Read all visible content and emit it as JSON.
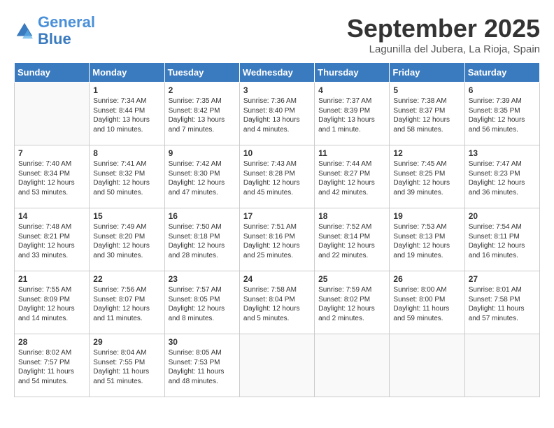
{
  "logo": {
    "line1": "General",
    "line2": "Blue"
  },
  "title": "September 2025",
  "location": "Lagunilla del Jubera, La Rioja, Spain",
  "weekdays": [
    "Sunday",
    "Monday",
    "Tuesday",
    "Wednesday",
    "Thursday",
    "Friday",
    "Saturday"
  ],
  "weeks": [
    [
      {
        "day": "",
        "sunrise": "",
        "sunset": "",
        "daylight": ""
      },
      {
        "day": "1",
        "sunrise": "7:34 AM",
        "sunset": "8:44 PM",
        "daylight": "13 hours and 10 minutes."
      },
      {
        "day": "2",
        "sunrise": "7:35 AM",
        "sunset": "8:42 PM",
        "daylight": "13 hours and 7 minutes."
      },
      {
        "day": "3",
        "sunrise": "7:36 AM",
        "sunset": "8:40 PM",
        "daylight": "13 hours and 4 minutes."
      },
      {
        "day": "4",
        "sunrise": "7:37 AM",
        "sunset": "8:39 PM",
        "daylight": "13 hours and 1 minute."
      },
      {
        "day": "5",
        "sunrise": "7:38 AM",
        "sunset": "8:37 PM",
        "daylight": "12 hours and 58 minutes."
      },
      {
        "day": "6",
        "sunrise": "7:39 AM",
        "sunset": "8:35 PM",
        "daylight": "12 hours and 56 minutes."
      }
    ],
    [
      {
        "day": "7",
        "sunrise": "7:40 AM",
        "sunset": "8:34 PM",
        "daylight": "12 hours and 53 minutes."
      },
      {
        "day": "8",
        "sunrise": "7:41 AM",
        "sunset": "8:32 PM",
        "daylight": "12 hours and 50 minutes."
      },
      {
        "day": "9",
        "sunrise": "7:42 AM",
        "sunset": "8:30 PM",
        "daylight": "12 hours and 47 minutes."
      },
      {
        "day": "10",
        "sunrise": "7:43 AM",
        "sunset": "8:28 PM",
        "daylight": "12 hours and 45 minutes."
      },
      {
        "day": "11",
        "sunrise": "7:44 AM",
        "sunset": "8:27 PM",
        "daylight": "12 hours and 42 minutes."
      },
      {
        "day": "12",
        "sunrise": "7:45 AM",
        "sunset": "8:25 PM",
        "daylight": "12 hours and 39 minutes."
      },
      {
        "day": "13",
        "sunrise": "7:47 AM",
        "sunset": "8:23 PM",
        "daylight": "12 hours and 36 minutes."
      }
    ],
    [
      {
        "day": "14",
        "sunrise": "7:48 AM",
        "sunset": "8:21 PM",
        "daylight": "12 hours and 33 minutes."
      },
      {
        "day": "15",
        "sunrise": "7:49 AM",
        "sunset": "8:20 PM",
        "daylight": "12 hours and 30 minutes."
      },
      {
        "day": "16",
        "sunrise": "7:50 AM",
        "sunset": "8:18 PM",
        "daylight": "12 hours and 28 minutes."
      },
      {
        "day": "17",
        "sunrise": "7:51 AM",
        "sunset": "8:16 PM",
        "daylight": "12 hours and 25 minutes."
      },
      {
        "day": "18",
        "sunrise": "7:52 AM",
        "sunset": "8:14 PM",
        "daylight": "12 hours and 22 minutes."
      },
      {
        "day": "19",
        "sunrise": "7:53 AM",
        "sunset": "8:13 PM",
        "daylight": "12 hours and 19 minutes."
      },
      {
        "day": "20",
        "sunrise": "7:54 AM",
        "sunset": "8:11 PM",
        "daylight": "12 hours and 16 minutes."
      }
    ],
    [
      {
        "day": "21",
        "sunrise": "7:55 AM",
        "sunset": "8:09 PM",
        "daylight": "12 hours and 14 minutes."
      },
      {
        "day": "22",
        "sunrise": "7:56 AM",
        "sunset": "8:07 PM",
        "daylight": "12 hours and 11 minutes."
      },
      {
        "day": "23",
        "sunrise": "7:57 AM",
        "sunset": "8:05 PM",
        "daylight": "12 hours and 8 minutes."
      },
      {
        "day": "24",
        "sunrise": "7:58 AM",
        "sunset": "8:04 PM",
        "daylight": "12 hours and 5 minutes."
      },
      {
        "day": "25",
        "sunrise": "7:59 AM",
        "sunset": "8:02 PM",
        "daylight": "12 hours and 2 minutes."
      },
      {
        "day": "26",
        "sunrise": "8:00 AM",
        "sunset": "8:00 PM",
        "daylight": "11 hours and 59 minutes."
      },
      {
        "day": "27",
        "sunrise": "8:01 AM",
        "sunset": "7:58 PM",
        "daylight": "11 hours and 57 minutes."
      }
    ],
    [
      {
        "day": "28",
        "sunrise": "8:02 AM",
        "sunset": "7:57 PM",
        "daylight": "11 hours and 54 minutes."
      },
      {
        "day": "29",
        "sunrise": "8:04 AM",
        "sunset": "7:55 PM",
        "daylight": "11 hours and 51 minutes."
      },
      {
        "day": "30",
        "sunrise": "8:05 AM",
        "sunset": "7:53 PM",
        "daylight": "11 hours and 48 minutes."
      },
      {
        "day": "",
        "sunrise": "",
        "sunset": "",
        "daylight": ""
      },
      {
        "day": "",
        "sunrise": "",
        "sunset": "",
        "daylight": ""
      },
      {
        "day": "",
        "sunrise": "",
        "sunset": "",
        "daylight": ""
      },
      {
        "day": "",
        "sunrise": "",
        "sunset": "",
        "daylight": ""
      }
    ]
  ],
  "labels": {
    "sunrise": "Sunrise:",
    "sunset": "Sunset:",
    "daylight": "Daylight:"
  }
}
